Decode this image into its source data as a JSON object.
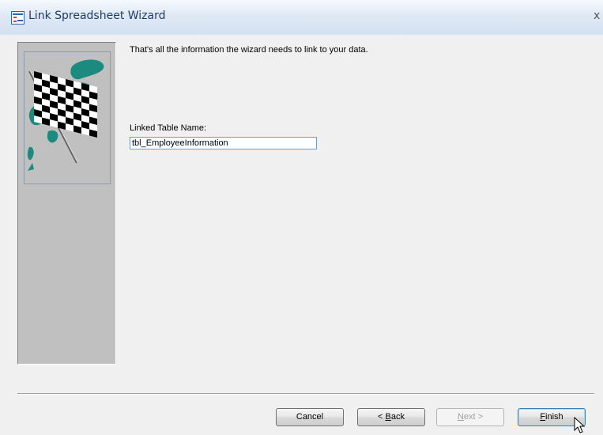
{
  "window": {
    "title": "Link Spreadsheet Wizard",
    "close_glyph": "x"
  },
  "content": {
    "message": "That's all the information the wizard needs to link to your data.",
    "field_label": "Linked Table Name:",
    "field_value": "tbl_EmployeeInformation"
  },
  "buttons": {
    "cancel": "Cancel",
    "back_accel": "B",
    "back_rest": "ack",
    "back_prefix": "< ",
    "next_accel": "N",
    "next_rest": "ext >",
    "finish_accel": "F",
    "finish_rest": "inish",
    "next_enabled": false
  },
  "colors": {
    "title_text": "#1e3a5f",
    "side_panel": "#c0c0c0",
    "flag_accent": "#1d8a80"
  },
  "icons": {
    "app": "spreadsheet-icon",
    "side_image": "checkered-flag-icon",
    "pointer": "mouse-pointer-icon"
  }
}
